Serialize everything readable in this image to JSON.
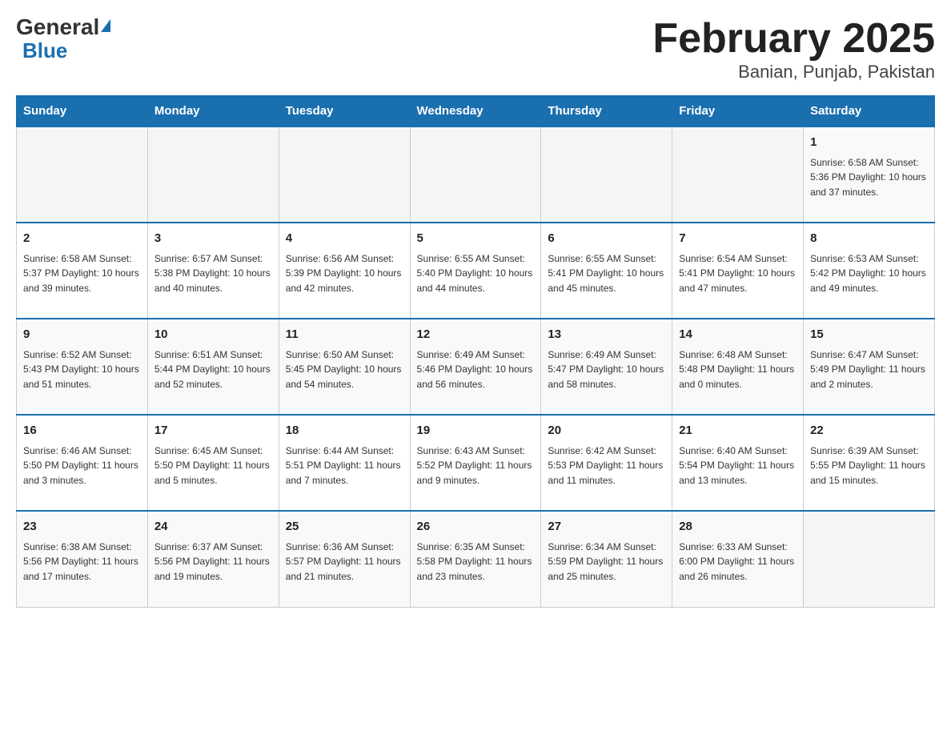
{
  "header": {
    "logo_general": "General",
    "logo_blue": "Blue",
    "title": "February 2025",
    "subtitle": "Banian, Punjab, Pakistan"
  },
  "days_of_week": [
    "Sunday",
    "Monday",
    "Tuesday",
    "Wednesday",
    "Thursday",
    "Friday",
    "Saturday"
  ],
  "weeks": [
    [
      {
        "day": "",
        "info": ""
      },
      {
        "day": "",
        "info": ""
      },
      {
        "day": "",
        "info": ""
      },
      {
        "day": "",
        "info": ""
      },
      {
        "day": "",
        "info": ""
      },
      {
        "day": "",
        "info": ""
      },
      {
        "day": "1",
        "info": "Sunrise: 6:58 AM\nSunset: 5:36 PM\nDaylight: 10 hours\nand 37 minutes."
      }
    ],
    [
      {
        "day": "2",
        "info": "Sunrise: 6:58 AM\nSunset: 5:37 PM\nDaylight: 10 hours\nand 39 minutes."
      },
      {
        "day": "3",
        "info": "Sunrise: 6:57 AM\nSunset: 5:38 PM\nDaylight: 10 hours\nand 40 minutes."
      },
      {
        "day": "4",
        "info": "Sunrise: 6:56 AM\nSunset: 5:39 PM\nDaylight: 10 hours\nand 42 minutes."
      },
      {
        "day": "5",
        "info": "Sunrise: 6:55 AM\nSunset: 5:40 PM\nDaylight: 10 hours\nand 44 minutes."
      },
      {
        "day": "6",
        "info": "Sunrise: 6:55 AM\nSunset: 5:41 PM\nDaylight: 10 hours\nand 45 minutes."
      },
      {
        "day": "7",
        "info": "Sunrise: 6:54 AM\nSunset: 5:41 PM\nDaylight: 10 hours\nand 47 minutes."
      },
      {
        "day": "8",
        "info": "Sunrise: 6:53 AM\nSunset: 5:42 PM\nDaylight: 10 hours\nand 49 minutes."
      }
    ],
    [
      {
        "day": "9",
        "info": "Sunrise: 6:52 AM\nSunset: 5:43 PM\nDaylight: 10 hours\nand 51 minutes."
      },
      {
        "day": "10",
        "info": "Sunrise: 6:51 AM\nSunset: 5:44 PM\nDaylight: 10 hours\nand 52 minutes."
      },
      {
        "day": "11",
        "info": "Sunrise: 6:50 AM\nSunset: 5:45 PM\nDaylight: 10 hours\nand 54 minutes."
      },
      {
        "day": "12",
        "info": "Sunrise: 6:49 AM\nSunset: 5:46 PM\nDaylight: 10 hours\nand 56 minutes."
      },
      {
        "day": "13",
        "info": "Sunrise: 6:49 AM\nSunset: 5:47 PM\nDaylight: 10 hours\nand 58 minutes."
      },
      {
        "day": "14",
        "info": "Sunrise: 6:48 AM\nSunset: 5:48 PM\nDaylight: 11 hours\nand 0 minutes."
      },
      {
        "day": "15",
        "info": "Sunrise: 6:47 AM\nSunset: 5:49 PM\nDaylight: 11 hours\nand 2 minutes."
      }
    ],
    [
      {
        "day": "16",
        "info": "Sunrise: 6:46 AM\nSunset: 5:50 PM\nDaylight: 11 hours\nand 3 minutes."
      },
      {
        "day": "17",
        "info": "Sunrise: 6:45 AM\nSunset: 5:50 PM\nDaylight: 11 hours\nand 5 minutes."
      },
      {
        "day": "18",
        "info": "Sunrise: 6:44 AM\nSunset: 5:51 PM\nDaylight: 11 hours\nand 7 minutes."
      },
      {
        "day": "19",
        "info": "Sunrise: 6:43 AM\nSunset: 5:52 PM\nDaylight: 11 hours\nand 9 minutes."
      },
      {
        "day": "20",
        "info": "Sunrise: 6:42 AM\nSunset: 5:53 PM\nDaylight: 11 hours\nand 11 minutes."
      },
      {
        "day": "21",
        "info": "Sunrise: 6:40 AM\nSunset: 5:54 PM\nDaylight: 11 hours\nand 13 minutes."
      },
      {
        "day": "22",
        "info": "Sunrise: 6:39 AM\nSunset: 5:55 PM\nDaylight: 11 hours\nand 15 minutes."
      }
    ],
    [
      {
        "day": "23",
        "info": "Sunrise: 6:38 AM\nSunset: 5:56 PM\nDaylight: 11 hours\nand 17 minutes."
      },
      {
        "day": "24",
        "info": "Sunrise: 6:37 AM\nSunset: 5:56 PM\nDaylight: 11 hours\nand 19 minutes."
      },
      {
        "day": "25",
        "info": "Sunrise: 6:36 AM\nSunset: 5:57 PM\nDaylight: 11 hours\nand 21 minutes."
      },
      {
        "day": "26",
        "info": "Sunrise: 6:35 AM\nSunset: 5:58 PM\nDaylight: 11 hours\nand 23 minutes."
      },
      {
        "day": "27",
        "info": "Sunrise: 6:34 AM\nSunset: 5:59 PM\nDaylight: 11 hours\nand 25 minutes."
      },
      {
        "day": "28",
        "info": "Sunrise: 6:33 AM\nSunset: 6:00 PM\nDaylight: 11 hours\nand 26 minutes."
      },
      {
        "day": "",
        "info": ""
      }
    ]
  ]
}
